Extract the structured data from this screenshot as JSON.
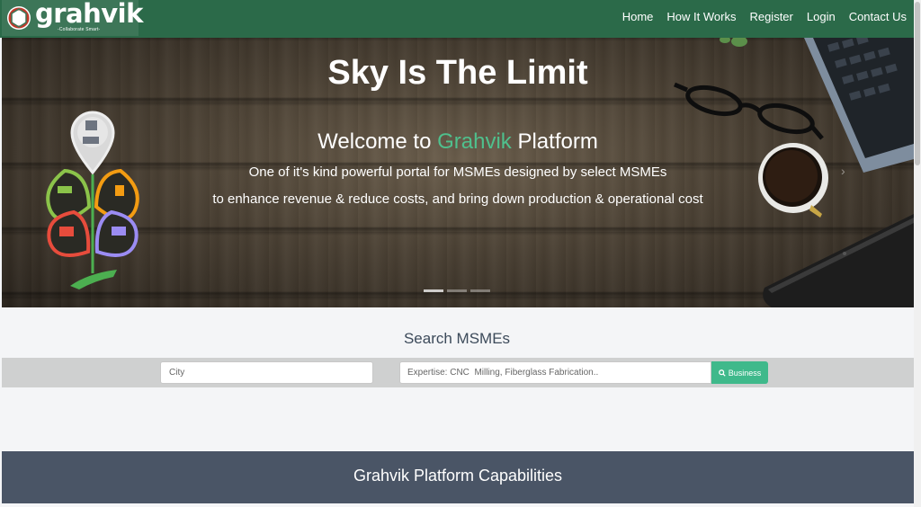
{
  "navbar": {
    "brand": "grahvik",
    "tagline": "-Collaborate Smart-",
    "links": [
      "Home",
      "How It Works",
      "Register",
      "Login",
      "Contact Us"
    ]
  },
  "hero": {
    "title": "Sky Is The Limit",
    "welcome_prefix": "Welcome to ",
    "welcome_accent": "Grahvik",
    "welcome_suffix": " Platform",
    "line1": "One of it's kind powerful portal for MSMEs designed by select MSMEs",
    "line2": "to enhance revenue & reduce costs, and bring down production & operational cost",
    "next_arrow": "›",
    "slides": 3,
    "active_slide": 1
  },
  "search": {
    "heading": "Search MSMEs",
    "city_placeholder": "City",
    "expertise_placeholder": "Expertise: CNC  Milling, Fiberglass Fabrication..",
    "button_label": "Business"
  },
  "capabilities": {
    "title": "Grahvik Platform Capabilities"
  },
  "colors": {
    "navbar": "#2b6a49",
    "accent": "#4fc08d",
    "button": "#3fb98b",
    "capabilities_band": "#4a5566"
  }
}
